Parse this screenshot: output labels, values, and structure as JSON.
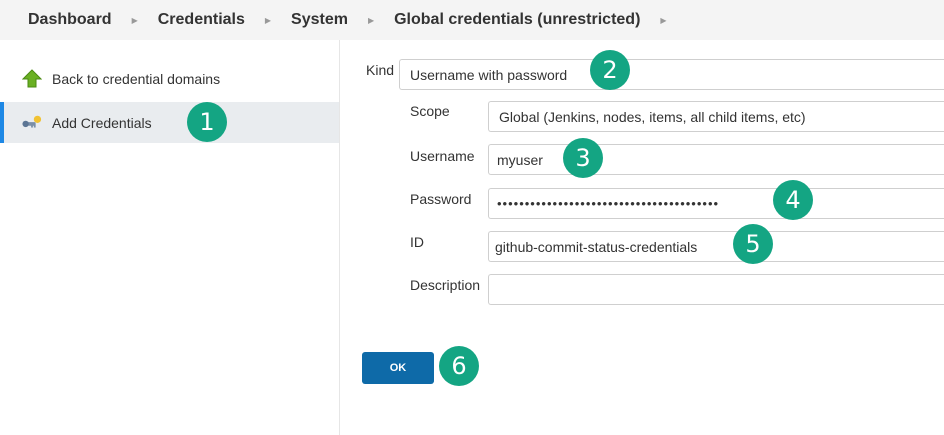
{
  "breadcrumb": {
    "items": [
      "Dashboard",
      "Credentials",
      "System",
      "Global credentials (unrestricted)"
    ]
  },
  "sidebar": {
    "items": [
      {
        "label": "Back to credential domains",
        "icon": "green-up-arrow-icon"
      },
      {
        "label": "Add Credentials",
        "icon": "key-credentials-icon",
        "selected": true
      }
    ]
  },
  "form": {
    "kind": {
      "label": "Kind",
      "value": "Username with password"
    },
    "scope": {
      "label": "Scope",
      "value": "Global (Jenkins, nodes, items, all child items, etc)"
    },
    "username": {
      "label": "Username",
      "value": "myuser"
    },
    "password": {
      "label": "Password",
      "value": "••••••••••••••••••••••••••••••••••••••••"
    },
    "id": {
      "label": "ID",
      "value": "github-commit-status-credentials"
    },
    "description": {
      "label": "Description",
      "value": ""
    },
    "ok_label": "OK"
  },
  "callouts": [
    "1",
    "2",
    "3",
    "4",
    "5",
    "6"
  ],
  "colors": {
    "accent": "#1e88e5",
    "callout": "#14a583",
    "button": "#0e6aa8"
  }
}
